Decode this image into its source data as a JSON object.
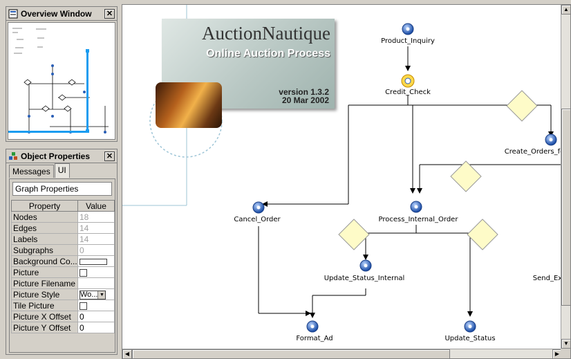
{
  "overview": {
    "title": "Overview Window",
    "close": "✕"
  },
  "props": {
    "title": "Object Properties",
    "close": "✕",
    "tabs": [
      {
        "label": "Messages"
      },
      {
        "label": "UI"
      }
    ],
    "graph_props": "Graph Properties",
    "headers": {
      "property": "Property",
      "value": "Value"
    },
    "rows": {
      "nodes": {
        "name": "Nodes",
        "value": "18"
      },
      "edges": {
        "name": "Edges",
        "value": "14"
      },
      "labels": {
        "name": "Labels",
        "value": "14"
      },
      "subgraphs": {
        "name": "Subgraphs",
        "value": "0"
      },
      "background": {
        "name": "Background Co..."
      },
      "picture": {
        "name": "Picture"
      },
      "picture_filename": {
        "name": "Picture Filename",
        "value": ""
      },
      "picture_style": {
        "name": "Picture Style",
        "value": "Wo..."
      },
      "tile_picture": {
        "name": "Tile Picture"
      },
      "picture_x": {
        "name": "Picture X Offset",
        "value": "0"
      },
      "picture_y": {
        "name": "Picture Y Offset",
        "value": "0"
      }
    }
  },
  "splash": {
    "brand": "AuctionNautique",
    "subtitle": "Online Auction Process",
    "version": "version 1.3.2",
    "date": "20 Mar 2002"
  },
  "nodes": {
    "product_inquiry": "Product_Inquiry",
    "credit_check": "Credit_Check",
    "create_orders": "Create_Orders_fo",
    "cancel_order": "Cancel_Order",
    "process_internal": "Process_Internal_Order",
    "update_status_internal": "Update_Status_Internal",
    "send_ex": "Send_Ex",
    "format_ad": "Format_Ad",
    "update_status": "Update_Status"
  },
  "icons": [
    "overview-window-icon",
    "object-properties-icon",
    "gear-icon",
    "credit-check-icon",
    "decision-diamond-icon",
    "scroll-up-icon",
    "scroll-down-icon",
    "scroll-left-icon",
    "scroll-right-icon"
  ],
  "colors": {
    "node_blue": "#2a5fb6",
    "diamond_fill": "#fefbc8",
    "selection": "#1a9cf0"
  }
}
